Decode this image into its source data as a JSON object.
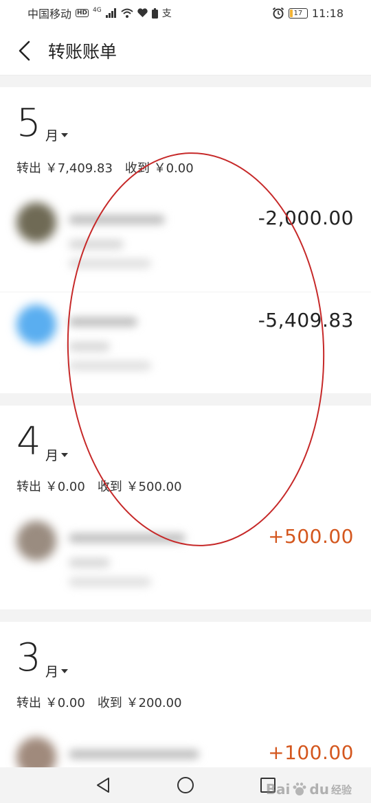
{
  "status": {
    "carrier": "中国移动",
    "hd": "HD",
    "net": "4G",
    "battery": "17",
    "time": "11:18",
    "extra_glyph": "支"
  },
  "header": {
    "title": "转账账单"
  },
  "months": [
    {
      "num": "5",
      "label": "月",
      "out_label": "转出",
      "out_value": "￥7,409.83",
      "in_label": "收到",
      "in_value": "￥0.00",
      "txns": [
        {
          "amount": "-2,000.00",
          "sign": "neg",
          "avatar_color": "#6f6a55"
        },
        {
          "amount": "-5,409.83",
          "sign": "neg",
          "avatar_color": "#5aaef0"
        }
      ]
    },
    {
      "num": "4",
      "label": "月",
      "out_label": "转出",
      "out_value": "￥0.00",
      "in_label": "收到",
      "in_value": "￥500.00",
      "txns": [
        {
          "amount": "+500.00",
          "sign": "pos",
          "avatar_color": "#9a8c80"
        }
      ]
    },
    {
      "num": "3",
      "label": "月",
      "out_label": "转出",
      "out_value": "￥0.00",
      "in_label": "收到",
      "in_value": "￥200.00",
      "txns": [
        {
          "amount": "+100.00",
          "sign": "pos",
          "avatar_color": "#a08a7c"
        }
      ]
    }
  ],
  "watermark": {
    "brand": "Bai",
    "paw": "du",
    "suffix": "经验"
  },
  "colors": {
    "accent_positive": "#d4571e",
    "annotation": "#c62828"
  }
}
